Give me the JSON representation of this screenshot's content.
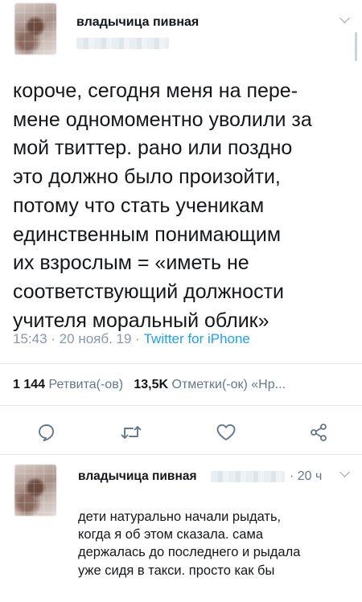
{
  "tweet": {
    "author_name": "владычица пивная",
    "text_lines": [
      "короче, сегодня меня на пере-",
      "мене одномоментно уволили за",
      "мой твиттер. рано или поздно",
      "это должно было произойти,",
      "потому что стать ученикам",
      "единственным понимающим",
      "их взрослым = «иметь не",
      "соответствующий должности",
      "учителя моральный облик»"
    ],
    "time": "15:43",
    "date": "20 нояб. 19",
    "separator": "·",
    "source": "Twitter for iPhone",
    "stats": {
      "retweets_count": "1 144",
      "retweets_label": "Ретвита(-ов)",
      "likes_count": "13,5K",
      "likes_label": "Отметки(-ок)",
      "extra": "«Нр..."
    },
    "actions": [
      "reply-icon",
      "retweet-icon",
      "like-icon",
      "share-icon"
    ]
  },
  "reply": {
    "author_name": "владычица пивная",
    "handle_fragment": "...",
    "time": "· 20 ч",
    "text_lines": [
      "дети натурально начали рыдать,",
      "когда я об этом сказала. сама",
      "держалась до последнего и рыдала",
      "уже сидя в такси. просто как бы"
    ]
  },
  "colors": {
    "text": "#14171a",
    "secondary": "#8899a6",
    "link": "#1da1f2",
    "icon": "#657786",
    "divider": "#e1e8ed"
  }
}
